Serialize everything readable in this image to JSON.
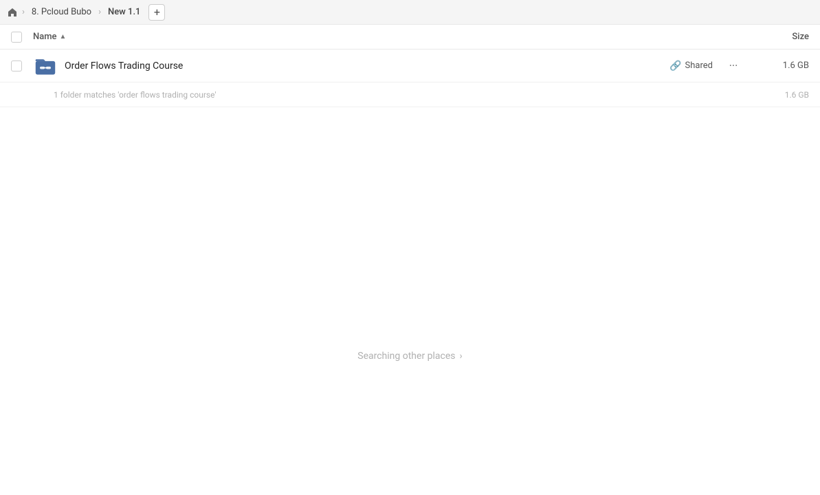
{
  "topbar": {
    "home_icon": "🏠",
    "breadcrumbs": [
      {
        "label": "8. Pcloud Bubo",
        "active": false
      },
      {
        "label": "New 1.1",
        "active": true
      }
    ],
    "add_button_label": "+"
  },
  "columns": {
    "name_label": "Name",
    "sort_indicator": "▲",
    "size_label": "Size"
  },
  "file_row": {
    "name": "Order Flows Trading Course",
    "shared_label": "Shared",
    "more_icon": "···",
    "size": "1.6 GB"
  },
  "match_info": {
    "text": "1 folder matches 'order flows trading course'",
    "size": "1.6 GB"
  },
  "searching": {
    "text": "Searching other places",
    "chevron": "›"
  },
  "colors": {
    "folder_blue": "#4a6fa5",
    "folder_dark": "#3a5a8a"
  }
}
